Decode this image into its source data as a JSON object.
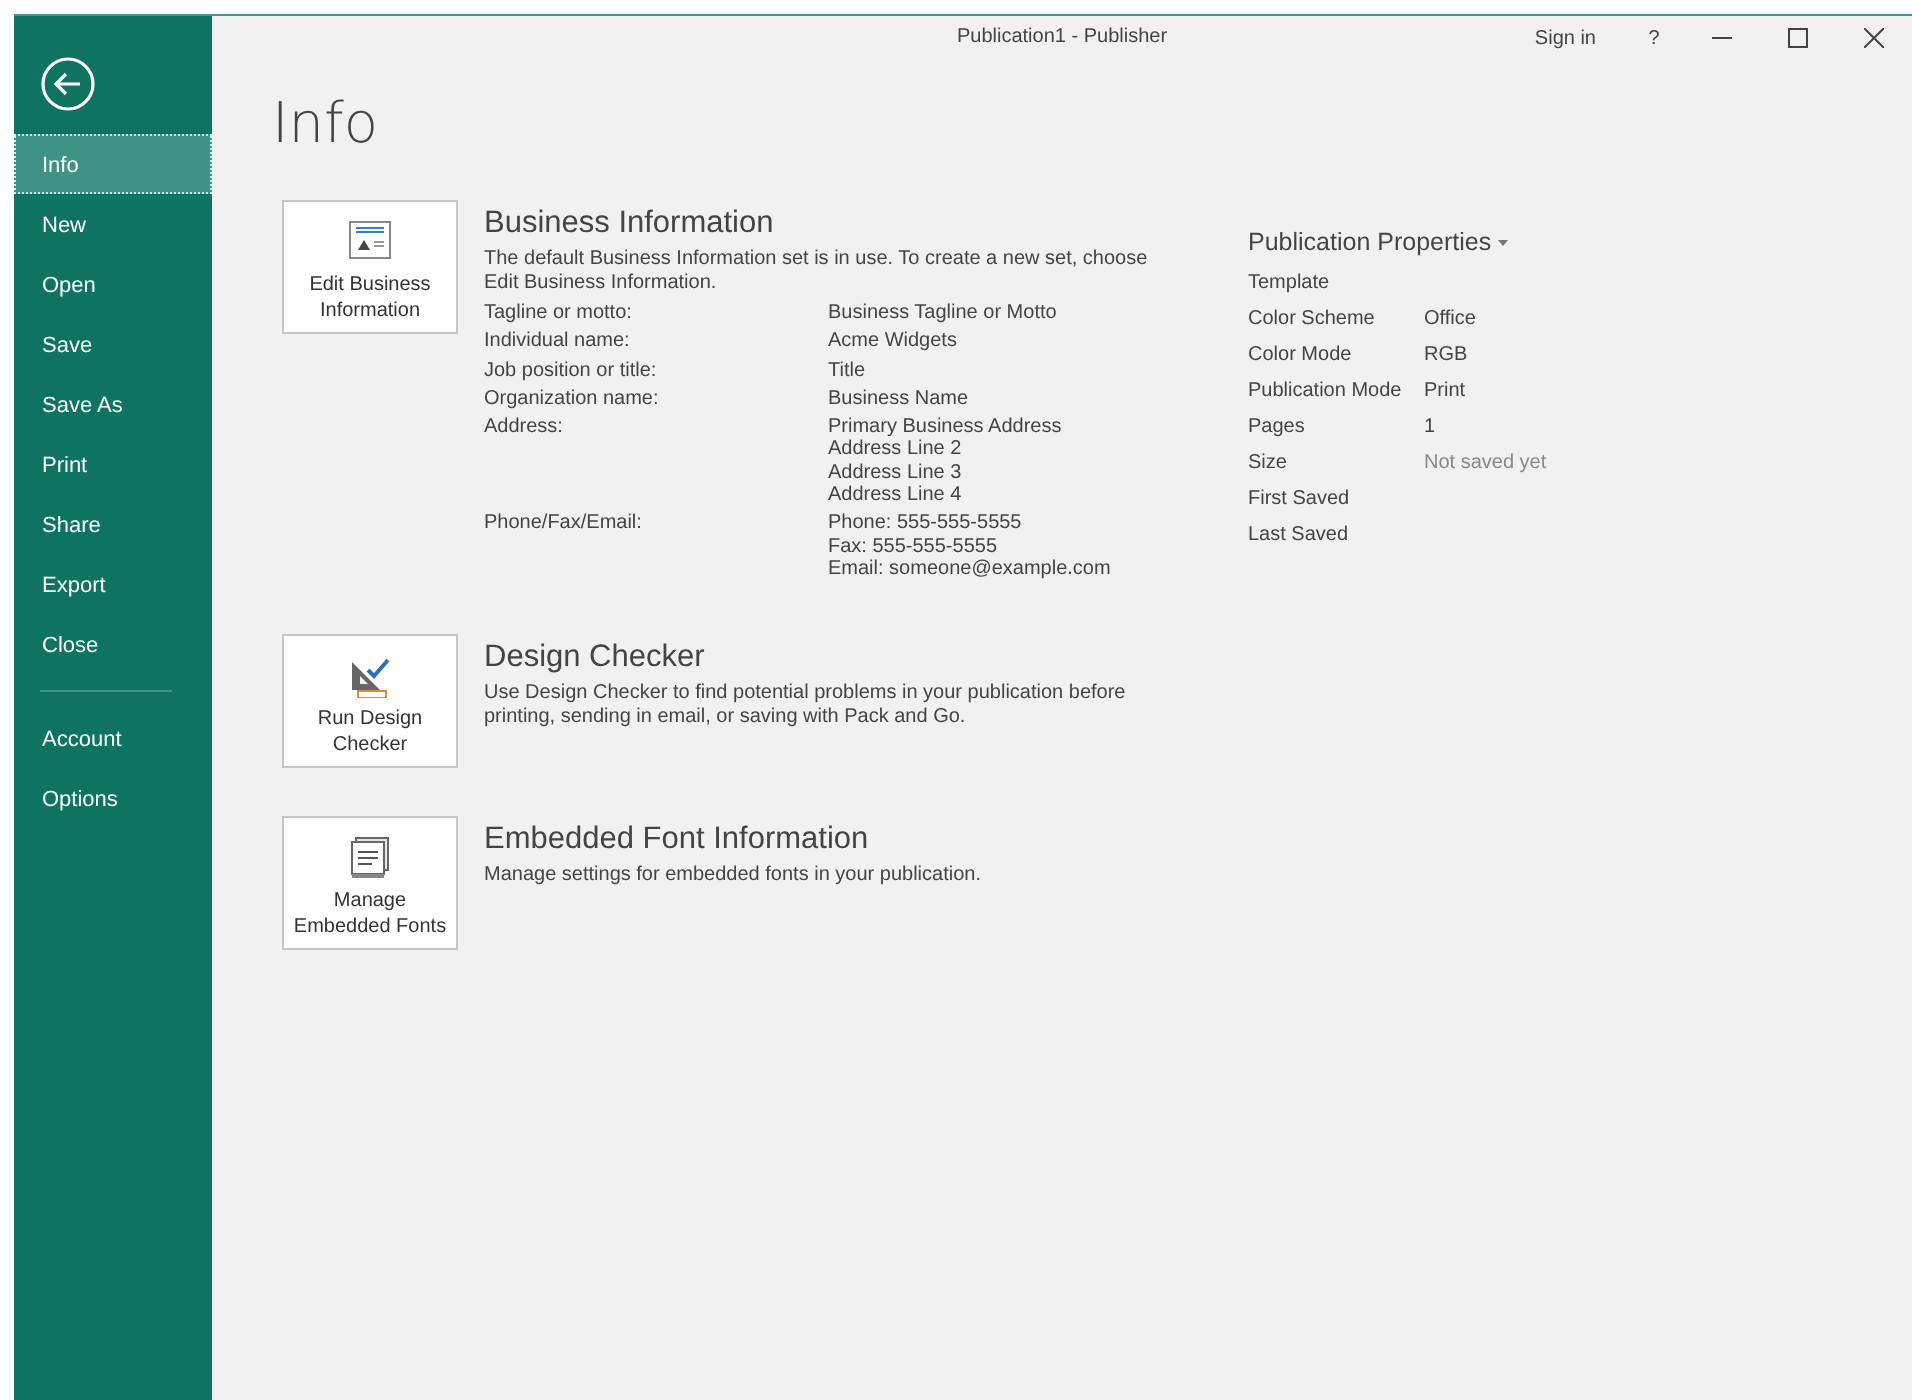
{
  "window": {
    "title": "Publication1 - Publisher",
    "sign_in": "Sign in",
    "help": "?"
  },
  "sidebar": {
    "items": [
      {
        "label": "Info",
        "selected": true
      },
      {
        "label": "New",
        "selected": false
      },
      {
        "label": "Open",
        "selected": false
      },
      {
        "label": "Save",
        "selected": false
      },
      {
        "label": "Save As",
        "selected": false
      },
      {
        "label": "Print",
        "selected": false
      },
      {
        "label": "Share",
        "selected": false
      },
      {
        "label": "Export",
        "selected": false
      },
      {
        "label": "Close",
        "selected": false
      }
    ],
    "footer_items": [
      {
        "label": "Account",
        "selected": false
      },
      {
        "label": "Options",
        "selected": false
      }
    ]
  },
  "page_title": "Info",
  "sections": [
    {
      "kind": "business",
      "button": "Edit Business Information",
      "heading": "Business Information",
      "description": "The default Business Information set is in use. To create a new set, choose Edit Business Information.",
      "fields": [
        {
          "label": "Tagline or motto:",
          "values": [
            "Business Tagline or Motto"
          ]
        },
        {
          "label": "Individual name:",
          "values": [
            "Acme Widgets"
          ]
        },
        {
          "label": "Job position or title:",
          "values": [
            "Title"
          ]
        },
        {
          "label": "Organization name:",
          "values": [
            "Business Name"
          ]
        },
        {
          "label": "Address:",
          "values": [
            "Primary Business Address",
            "Address Line 2",
            "Address Line 3",
            "Address Line 4"
          ]
        },
        {
          "label": "Phone/Fax/Email:",
          "values": [
            "Phone: 555-555-5555",
            "Fax: 555-555-5555",
            "Email: someone@example.com"
          ]
        }
      ]
    },
    {
      "kind": "checker",
      "button": "Run Design Checker",
      "heading": "Design Checker",
      "description": "Use Design Checker to find potential problems in your publication before printing, sending in email, or saving with Pack and Go."
    },
    {
      "kind": "fonts",
      "button": "Manage Embedded Fonts",
      "heading": "Embedded Font Information",
      "description": "Manage settings for embedded fonts in your publication."
    }
  ],
  "properties": {
    "heading": "Publication Properties",
    "rows": [
      {
        "label": "Template"
      },
      {
        "label": "Color Scheme",
        "value": "Office"
      },
      {
        "label": "Color Mode",
        "value": "RGB"
      },
      {
        "label": "Publication Mode",
        "value": "Print"
      },
      {
        "label": "Pages",
        "value": "1"
      },
      {
        "label": "Size",
        "value": "Not saved yet",
        "muted": true
      },
      {
        "label": "First Saved"
      },
      {
        "label": "Last Saved"
      }
    ]
  }
}
